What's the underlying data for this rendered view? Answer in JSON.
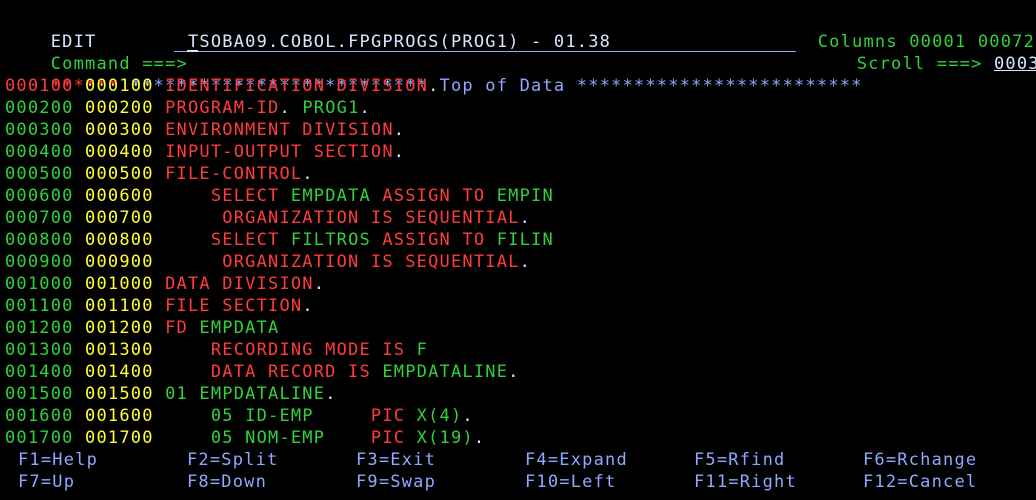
{
  "header": {
    "mode": "EDIT",
    "dataset": "TSOBA09.COBOL.FPGPROGS(PROG1) - 01.38",
    "columns_label": "Columns",
    "col_start": "00001",
    "col_end": "00072"
  },
  "command": {
    "label": "Command ===>",
    "value": "",
    "scroll_label": "Scroll ===>",
    "scroll_value": "0003"
  },
  "top_of_data": {
    "marker": "******",
    "text": " ************************** Top of Data *************************"
  },
  "lines": [
    {
      "no": "000100",
      "seq": "000100",
      "segs": [
        {
          "t": "IDENTIFICATION DIVISION",
          "c": "red"
        },
        {
          "t": ".",
          "c": "white"
        }
      ]
    },
    {
      "no": "000200",
      "seq": "000200",
      "segs": [
        {
          "t": "PROGRAM-ID",
          "c": "red"
        },
        {
          "t": ". ",
          "c": "white"
        },
        {
          "t": "PROG1",
          "c": "green"
        },
        {
          "t": ".",
          "c": "white"
        }
      ]
    },
    {
      "no": "000300",
      "seq": "000300",
      "segs": [
        {
          "t": "ENVIRONMENT DIVISION",
          "c": "red"
        },
        {
          "t": ".",
          "c": "white"
        }
      ]
    },
    {
      "no": "000400",
      "seq": "000400",
      "segs": [
        {
          "t": "INPUT-OUTPUT SECTION",
          "c": "red"
        },
        {
          "t": ".",
          "c": "white"
        }
      ]
    },
    {
      "no": "000500",
      "seq": "000500",
      "segs": [
        {
          "t": "FILE-CONTROL",
          "c": "red"
        },
        {
          "t": ".",
          "c": "white"
        }
      ]
    },
    {
      "no": "000600",
      "seq": "000600",
      "segs": [
        {
          "t": "    SELECT ",
          "c": "red"
        },
        {
          "t": "EMPDATA ",
          "c": "green"
        },
        {
          "t": "ASSIGN TO ",
          "c": "red"
        },
        {
          "t": "EMPIN",
          "c": "green"
        }
      ]
    },
    {
      "no": "000700",
      "seq": "000700",
      "segs": [
        {
          "t": "     ORGANIZATION IS SEQUENTIAL",
          "c": "red"
        },
        {
          "t": ".",
          "c": "white"
        }
      ]
    },
    {
      "no": "000800",
      "seq": "000800",
      "segs": [
        {
          "t": "    SELECT ",
          "c": "red"
        },
        {
          "t": "FILTROS ",
          "c": "green"
        },
        {
          "t": "ASSIGN TO ",
          "c": "red"
        },
        {
          "t": "FILIN",
          "c": "green"
        }
      ]
    },
    {
      "no": "000900",
      "seq": "000900",
      "segs": [
        {
          "t": "     ORGANIZATION IS SEQUENTIAL",
          "c": "red"
        },
        {
          "t": ".",
          "c": "white"
        }
      ]
    },
    {
      "no": "001000",
      "seq": "001000",
      "segs": [
        {
          "t": "DATA DIVISION",
          "c": "red"
        },
        {
          "t": ".",
          "c": "white"
        }
      ]
    },
    {
      "no": "001100",
      "seq": "001100",
      "segs": [
        {
          "t": "FILE SECTION",
          "c": "red"
        },
        {
          "t": ".",
          "c": "white"
        }
      ]
    },
    {
      "no": "001200",
      "seq": "001200",
      "segs": [
        {
          "t": "FD ",
          "c": "red"
        },
        {
          "t": "EMPDATA",
          "c": "green"
        }
      ]
    },
    {
      "no": "001300",
      "seq": "001300",
      "segs": [
        {
          "t": "    RECORDING MODE IS ",
          "c": "red"
        },
        {
          "t": "F",
          "c": "green"
        }
      ]
    },
    {
      "no": "001400",
      "seq": "001400",
      "segs": [
        {
          "t": "    DATA RECORD IS ",
          "c": "red"
        },
        {
          "t": "EMPDATALINE",
          "c": "green"
        },
        {
          "t": ".",
          "c": "white"
        }
      ]
    },
    {
      "no": "001500",
      "seq": "001500",
      "segs": [
        {
          "t": "01 EMPDATALINE",
          "c": "green"
        },
        {
          "t": ".",
          "c": "white"
        }
      ]
    },
    {
      "no": "001600",
      "seq": "001600",
      "segs": [
        {
          "t": "    05 ID-EMP     ",
          "c": "green"
        },
        {
          "t": "PIC ",
          "c": "red"
        },
        {
          "t": "X(4)",
          "c": "green"
        },
        {
          "t": ".",
          "c": "white"
        }
      ]
    },
    {
      "no": "001700",
      "seq": "001700",
      "segs": [
        {
          "t": "    05 NOM-EMP    ",
          "c": "green"
        },
        {
          "t": "PIC ",
          "c": "red"
        },
        {
          "t": "X(19)",
          "c": "green"
        },
        {
          "t": ".",
          "c": "white"
        }
      ]
    }
  ],
  "fkeys": [
    [
      "F1=Help",
      "F2=Split",
      "F3=Exit",
      "F4=Expand",
      "F5=Rfind",
      "F6=Rchange"
    ],
    [
      "F7=Up",
      "F8=Down",
      "F9=Swap",
      "F10=Left",
      "F11=Right",
      "F12=Cancel"
    ]
  ],
  "colors": {
    "background": "#000000",
    "white": "#d8e6ff",
    "green": "#2fd23a",
    "red": "#ff3b3b",
    "yellow": "#ffff33",
    "blue": "#8fa8ff"
  }
}
